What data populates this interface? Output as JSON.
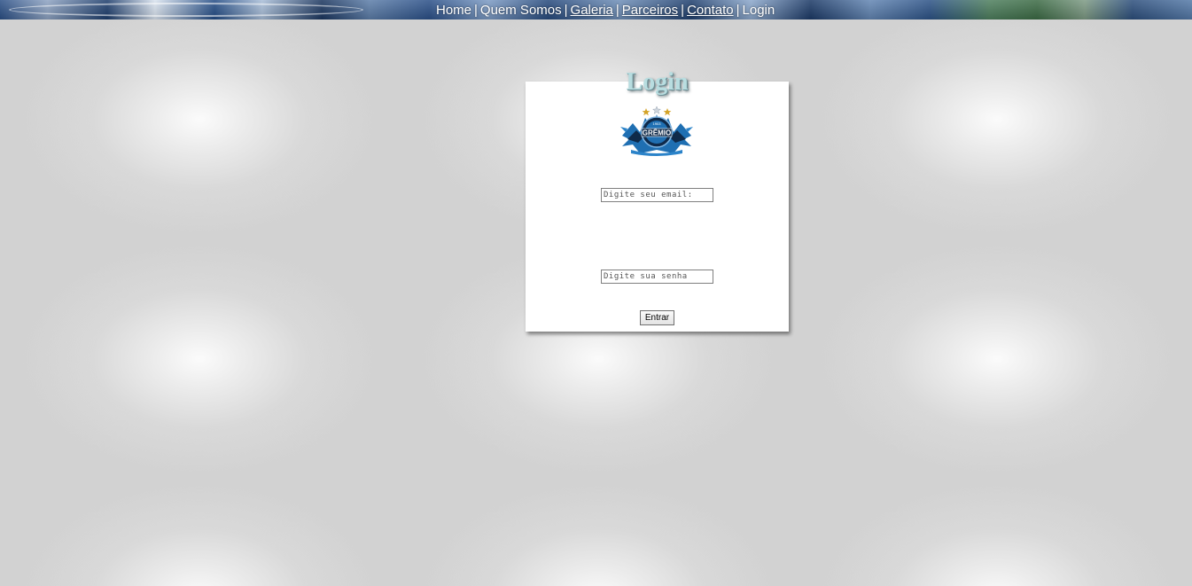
{
  "nav": {
    "items": [
      "Home",
      "Quem Somos",
      "Galeria",
      "Parceiros",
      "Contato",
      "Login"
    ],
    "separator": "|"
  },
  "login": {
    "title": "Login",
    "email_placeholder": "Digite seu email:",
    "email_value": "",
    "password_placeholder": "Digite sua senha",
    "password_value": "",
    "submit_label": "Entrar"
  },
  "logo": {
    "text": "GRÊMIO",
    "year": "1903",
    "stars": 3,
    "colors": {
      "primary": "#1f6fb2",
      "dark": "#0f2a4a",
      "star_gold": "#d4a42a",
      "star_light": "#cfd6de"
    }
  },
  "colors": {
    "nav_text": "#ffffff",
    "card_bg": "#ffffff",
    "title": "#b8dde0",
    "page_bg": "#d2d2d2"
  }
}
